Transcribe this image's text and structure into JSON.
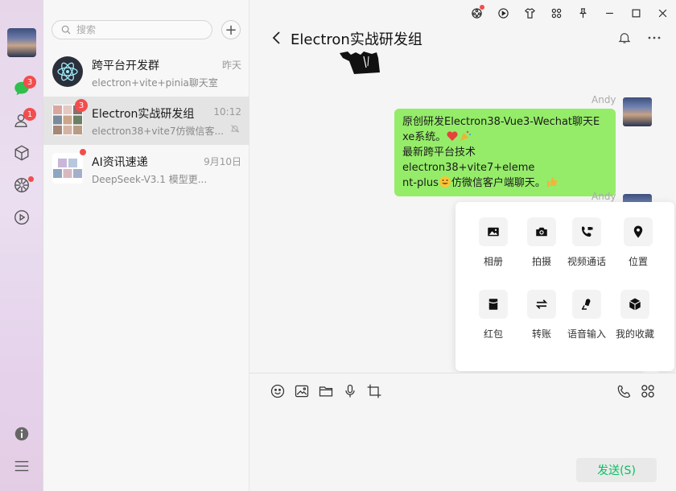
{
  "search": {
    "placeholder": "搜索"
  },
  "rail": {
    "chat_badge": "3",
    "contacts_badge": "1"
  },
  "conversations": [
    {
      "name": "跨平台开发群",
      "time": "昨天",
      "preview": "electron+vite+pinia聊天室"
    },
    {
      "name": "Electron实战研发组",
      "time": "10:12",
      "preview": "electron38+vite7仿微信客...",
      "badge": "3"
    },
    {
      "name": "AI资讯速递",
      "time": "9月10日",
      "preview": "DeepSeek-V3.1 模型更..."
    }
  ],
  "chat": {
    "title": "Electron实战研发组",
    "messages": [
      {
        "sender": "Andy",
        "line1": "原创研发Electron38-Vue3-Wechat聊天E",
        "line2": "xe系统。",
        "line3": "最新跨平台技术electron38+vite7+eleme",
        "line4": "nt-plus",
        "line4b": "仿微信客户端聊天。"
      },
      {
        "sender": "Andy"
      }
    ]
  },
  "panel": {
    "items": [
      {
        "label": "相册",
        "icon": "image-icon"
      },
      {
        "label": "拍摄",
        "icon": "camera-icon"
      },
      {
        "label": "视频通话",
        "icon": "video-call-icon"
      },
      {
        "label": "位置",
        "icon": "location-icon"
      },
      {
        "label": "红包",
        "icon": "red-packet-icon"
      },
      {
        "label": "转账",
        "icon": "transfer-icon"
      },
      {
        "label": "语音输入",
        "icon": "voice-input-icon"
      },
      {
        "label": "我的收藏",
        "icon": "favorites-icon"
      }
    ]
  },
  "input": {
    "send_label": "发送(S)"
  },
  "colors": {
    "bubble": "#95ec69",
    "badge": "#f24d4d",
    "send_text": "#07c160"
  }
}
